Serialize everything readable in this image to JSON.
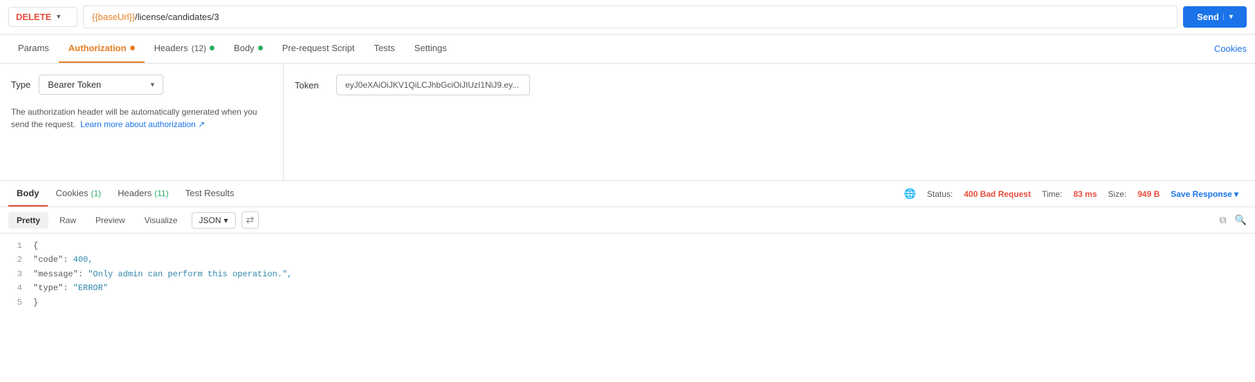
{
  "topbar": {
    "method": "DELETE",
    "method_chevron": "▾",
    "url_prefix": "{{baseUrl}}",
    "url_suffix": "/license/candidates/3",
    "send_label": "Send",
    "send_chevron": "▾"
  },
  "tabs": {
    "params": "Params",
    "authorization": "Authorization",
    "headers": "Headers",
    "headers_count": "(12)",
    "body": "Body",
    "pre_request": "Pre-request Script",
    "tests": "Tests",
    "settings": "Settings",
    "cookies": "Cookies"
  },
  "auth": {
    "type_label": "Type",
    "type_value": "Bearer Token",
    "description_line1": "The authorization header will be automatically generated when you",
    "description_line2": "send the request.",
    "learn_more": "Learn more about authorization ↗",
    "token_label": "Token",
    "token_value": "eyJ0eXAiOiJKV1QiLCJhbGciOiJIUzI1NiJ9.ey..."
  },
  "response": {
    "body_tab": "Body",
    "cookies_tab": "Cookies",
    "cookies_count": "(1)",
    "headers_tab": "Headers",
    "headers_count": "(11)",
    "test_results_tab": "Test Results",
    "globe_icon": "🌐",
    "status_label": "Status:",
    "status_value": "400 Bad Request",
    "time_label": "Time:",
    "time_value": "83 ms",
    "size_label": "Size:",
    "size_value": "949 B",
    "save_response": "Save Response",
    "save_chevron": "▾"
  },
  "code_tabs": {
    "pretty": "Pretty",
    "raw": "Raw",
    "preview": "Preview",
    "visualize": "Visualize",
    "json_format": "JSON",
    "chevron": "▾"
  },
  "code": {
    "line1": "{",
    "line2_key": "\"code\"",
    "line2_colon": ": ",
    "line2_val": "400,",
    "line3_key": "\"message\"",
    "line3_colon": ": ",
    "line3_val": "\"Only admin can perform this operation.\",",
    "line4_key": "\"type\"",
    "line4_colon": ": ",
    "line4_val": "\"ERROR\"",
    "line5": "}"
  }
}
